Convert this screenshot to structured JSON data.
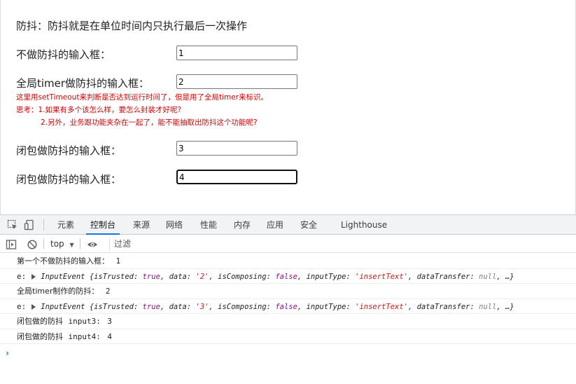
{
  "page": {
    "title": "防抖：防抖就是在单位时间内只执行最后一次操作",
    "rows": [
      {
        "label": "不做防抖的输入框：",
        "value": "1"
      },
      {
        "label": "全局timer做防抖的输入框：",
        "value": "2"
      },
      {
        "label": "闭包做防抖的输入框：",
        "value": "3"
      },
      {
        "label": "闭包做防抖的输入框：",
        "value": "4"
      }
    ],
    "notes": [
      "这里用setTimeout来判断是否达到运行时间了，但是用了全局timer来标识。",
      "思考：1.如果有多个该怎么样，要怎么封装才好呢?",
      "2.另外，业务跟功能夹杂在一起了，能不能抽取出防抖这个功能呢?"
    ]
  },
  "devtools": {
    "tabs": [
      "元素",
      "控制台",
      "来源",
      "网络",
      "性能",
      "内存",
      "应用",
      "安全",
      "Lighthouse"
    ],
    "active_tab": "控制台",
    "context": "top",
    "filter_placeholder": "过滤",
    "logs": {
      "l1": {
        "text": "第一个不做防抖的输入框：",
        "val": "1"
      },
      "e1": {
        "prefix": "e:",
        "cls": "InputEvent",
        "trusted": "true",
        "data": "'2'",
        "composing": "false",
        "itype": "'insertText'",
        "dt": "null"
      },
      "l2": {
        "text": "全局timer制作的防抖：",
        "val": "2"
      },
      "e2": {
        "prefix": "e:",
        "cls": "InputEvent",
        "trusted": "true",
        "data": "'3'",
        "composing": "false",
        "itype": "'insertText'",
        "dt": "null"
      },
      "l3": {
        "text": "闭包做的防抖",
        "mid": "input3:",
        "val": "3"
      },
      "l4": {
        "text": "闭包做的防抖",
        "mid": "input4:",
        "val": "4"
      }
    },
    "prompt": "›"
  }
}
